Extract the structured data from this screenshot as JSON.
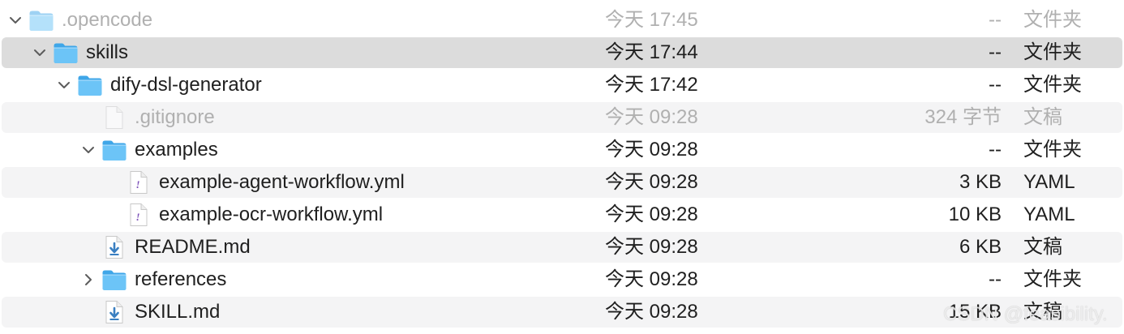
{
  "rows": [
    {
      "name": ".opencode",
      "date": "今天 17:45",
      "size": "--",
      "kind": "文件夹",
      "icon": "folder-icon",
      "disclosure": "chevron-down-icon",
      "dim": true
    },
    {
      "name": "skills",
      "date": "今天 17:44",
      "size": "--",
      "kind": "文件夹",
      "icon": "folder-icon",
      "disclosure": "chevron-down-icon",
      "selected": true
    },
    {
      "name": "dify-dsl-generator",
      "date": "今天 17:42",
      "size": "--",
      "kind": "文件夹",
      "icon": "folder-icon",
      "disclosure": "chevron-down-icon"
    },
    {
      "name": ".gitignore",
      "date": "今天 09:28",
      "size": "324 字节",
      "kind": "文稿",
      "icon": "plain-file-icon",
      "dim": true
    },
    {
      "name": "examples",
      "date": "今天 09:28",
      "size": "--",
      "kind": "文件夹",
      "icon": "folder-icon",
      "disclosure": "chevron-down-icon"
    },
    {
      "name": "example-agent-workflow.yml",
      "date": "今天 09:28",
      "size": "3 KB",
      "kind": "YAML",
      "icon": "yaml-file-icon"
    },
    {
      "name": "example-ocr-workflow.yml",
      "date": "今天 09:28",
      "size": "10 KB",
      "kind": "YAML",
      "icon": "yaml-file-icon"
    },
    {
      "name": "README.md",
      "date": "今天 09:28",
      "size": "6 KB",
      "kind": "文稿",
      "icon": "markdown-file-icon"
    },
    {
      "name": "references",
      "date": "今天 09:28",
      "size": "--",
      "kind": "文件夹",
      "icon": "folder-icon",
      "disclosure": "chevron-right-icon"
    },
    {
      "name": "SKILL.md",
      "date": "今天 09:28",
      "size": "15 KB",
      "kind": "文稿",
      "icon": "markdown-file-icon"
    }
  ],
  "watermark": "CSDN @feasibility."
}
